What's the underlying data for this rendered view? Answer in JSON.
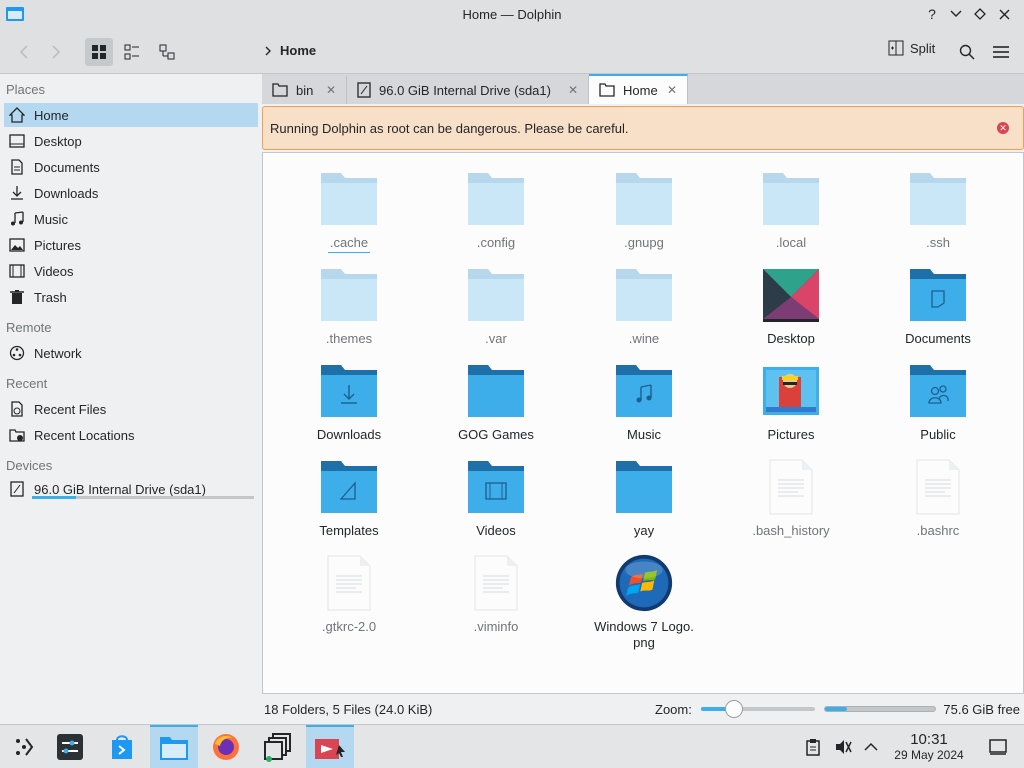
{
  "window": {
    "title": "Home — Dolphin"
  },
  "toolbar": {
    "breadcrumb": "Home",
    "split_label": "Split"
  },
  "sidebar": {
    "places_title": "Places",
    "places": [
      {
        "label": "Home",
        "icon": "home-icon"
      },
      {
        "label": "Desktop",
        "icon": "desktop-icon"
      },
      {
        "label": "Documents",
        "icon": "documents-icon"
      },
      {
        "label": "Downloads",
        "icon": "downloads-icon"
      },
      {
        "label": "Music",
        "icon": "music-icon"
      },
      {
        "label": "Pictures",
        "icon": "pictures-icon"
      },
      {
        "label": "Videos",
        "icon": "videos-icon"
      },
      {
        "label": "Trash",
        "icon": "trash-icon"
      }
    ],
    "remote_title": "Remote",
    "remote": [
      {
        "label": "Network",
        "icon": "network-icon"
      }
    ],
    "recent_title": "Recent",
    "recent": [
      {
        "label": "Recent Files",
        "icon": "recent-files-icon"
      },
      {
        "label": "Recent Locations",
        "icon": "recent-locations-icon"
      }
    ],
    "devices_title": "Devices",
    "devices": [
      {
        "label": "96.0 GiB Internal Drive (sda1)",
        "icon": "drive-icon",
        "used_fraction": 0.2
      }
    ]
  },
  "tabs": [
    {
      "label": "bin",
      "active": false
    },
    {
      "label": "96.0 GiB Internal Drive (sda1)",
      "active": false
    },
    {
      "label": "Home",
      "active": true
    }
  ],
  "warning": {
    "text": "Running Dolphin as root can be dangerous. Please be careful."
  },
  "files": [
    {
      "name": ".cache",
      "type": "folder",
      "hidden": true
    },
    {
      "name": ".config",
      "type": "folder",
      "hidden": true
    },
    {
      "name": ".gnupg",
      "type": "folder",
      "hidden": true
    },
    {
      "name": ".local",
      "type": "folder",
      "hidden": true
    },
    {
      "name": ".ssh",
      "type": "folder",
      "hidden": true
    },
    {
      "name": ".themes",
      "type": "folder",
      "hidden": true
    },
    {
      "name": ".var",
      "type": "folder",
      "hidden": true
    },
    {
      "name": ".wine",
      "type": "folder",
      "hidden": true
    },
    {
      "name": "Desktop",
      "type": "desktop-folder",
      "hidden": false
    },
    {
      "name": "Documents",
      "type": "documents-folder",
      "hidden": false
    },
    {
      "name": "Downloads",
      "type": "downloads-folder",
      "hidden": false
    },
    {
      "name": "GOG Games",
      "type": "folder-blue",
      "hidden": false
    },
    {
      "name": "Music",
      "type": "music-folder",
      "hidden": false
    },
    {
      "name": "Pictures",
      "type": "pictures-folder",
      "hidden": false
    },
    {
      "name": "Public",
      "type": "public-folder",
      "hidden": false
    },
    {
      "name": "Templates",
      "type": "templates-folder",
      "hidden": false
    },
    {
      "name": "Videos",
      "type": "videos-folder",
      "hidden": false
    },
    {
      "name": "yay",
      "type": "folder-blue",
      "hidden": false
    },
    {
      "name": ".bash_history",
      "type": "text-file",
      "hidden": true
    },
    {
      "name": ".bashrc",
      "type": "text-file",
      "hidden": true
    },
    {
      "name": ".gtkrc-2.0",
      "type": "text-file",
      "hidden": true
    },
    {
      "name": ".viminfo",
      "type": "text-file",
      "hidden": true
    },
    {
      "name": "Windows 7 Logo.\npng",
      "type": "image-file",
      "hidden": false
    }
  ],
  "status": {
    "summary": "18 Folders, 5 Files (24.0 KiB)",
    "zoom_label": "Zoom:",
    "zoom_level_fraction": 0.29,
    "free_space": "75.6 GiB free",
    "used_fraction": 0.2
  },
  "taskbar": {
    "apps": [
      "app-launcher-icon",
      "system-settings-icon",
      "discover-icon",
      "dolphin-icon",
      "firefox-icon",
      "window-switcher-icon",
      "kdeconnect-icon"
    ],
    "time": "10:31",
    "date": "29 May 2024"
  },
  "colors": {
    "accent": "#3daee9",
    "warning_bg": "#f7dfc8",
    "folder_light": "#a3d6f5",
    "folder_dark": "#2f9be0"
  }
}
